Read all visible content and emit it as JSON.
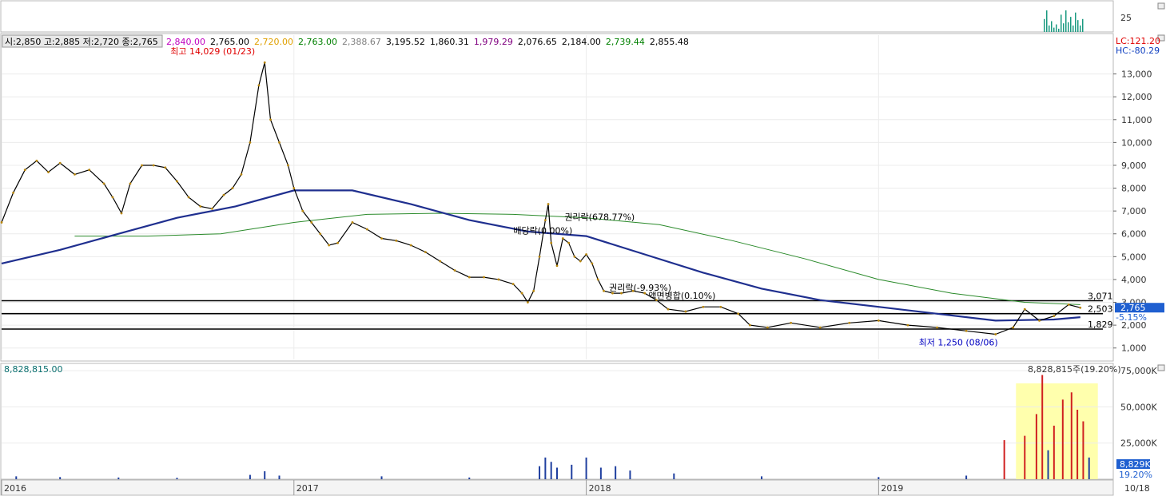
{
  "chart_data": [
    {
      "type": "line",
      "panel": "price",
      "info_bar": {
        "ohlc": "시:2,850 고:2,885 저:2,720 종:2,765",
        "ma_values": [
          {
            "text": "2,840.00",
            "color": "#c000c0"
          },
          {
            "text": "2,765.00",
            "color": "#000000"
          },
          {
            "text": "2,720.00",
            "color": "#e0a000"
          },
          {
            "text": "2,763.00",
            "color": "#008000"
          },
          {
            "text": "2,388.67",
            "color": "#808080"
          },
          {
            "text": "3,195.52",
            "color": "#000000"
          },
          {
            "text": "1,860.31",
            "color": "#000000"
          },
          {
            "text": "1,979.29",
            "color": "#800080"
          },
          {
            "text": "2,076.65",
            "color": "#000000"
          },
          {
            "text": "2,184.00",
            "color": "#000000"
          },
          {
            "text": "2,739.44",
            "color": "#008000"
          },
          {
            "text": "2,855.48",
            "color": "#000000"
          }
        ]
      },
      "lc_label": "LC:121.20",
      "hc_label": "HC:-80.29",
      "y_ticks": [
        1000,
        2000,
        3000,
        4000,
        5000,
        6000,
        7000,
        8000,
        9000,
        10000,
        11000,
        12000,
        13000
      ],
      "y_tick_labels": [
        "1,000",
        "2,000",
        "3,000",
        "4,000",
        "5,000",
        "6,000",
        "7,000",
        "8,000",
        "9,000",
        "10,000",
        "11,000",
        "12,000",
        "13,000"
      ],
      "ylim": [
        500,
        14700
      ],
      "x_labels": [
        "2016",
        "2017",
        "2018",
        "2019",
        "10/18"
      ],
      "x_label_dates": [
        2016.0,
        2017.0,
        2018.0,
        2019.0
      ],
      "xlim": [
        2016.0,
        2019.8
      ],
      "price_series": [
        [
          2016.0,
          6500
        ],
        [
          2016.04,
          7800
        ],
        [
          2016.08,
          8800
        ],
        [
          2016.12,
          9200
        ],
        [
          2016.16,
          8700
        ],
        [
          2016.2,
          9100
        ],
        [
          2016.25,
          8600
        ],
        [
          2016.3,
          8800
        ],
        [
          2016.35,
          8200
        ],
        [
          2016.38,
          7600
        ],
        [
          2016.41,
          6900
        ],
        [
          2016.44,
          8200
        ],
        [
          2016.48,
          9000
        ],
        [
          2016.52,
          9000
        ],
        [
          2016.56,
          8900
        ],
        [
          2016.6,
          8300
        ],
        [
          2016.64,
          7600
        ],
        [
          2016.68,
          7200
        ],
        [
          2016.72,
          7100
        ],
        [
          2016.76,
          7700
        ],
        [
          2016.79,
          8000
        ],
        [
          2016.82,
          8600
        ],
        [
          2016.85,
          10000
        ],
        [
          2016.88,
          12500
        ],
        [
          2016.9,
          13500
        ],
        [
          2016.92,
          11000
        ],
        [
          2016.95,
          10000
        ],
        [
          2016.98,
          9000
        ],
        [
          2017.0,
          8000
        ],
        [
          2017.03,
          7000
        ],
        [
          2017.06,
          6500
        ],
        [
          2017.09,
          6000
        ],
        [
          2017.12,
          5500
        ],
        [
          2017.15,
          5600
        ],
        [
          2017.2,
          6500
        ],
        [
          2017.25,
          6200
        ],
        [
          2017.3,
          5800
        ],
        [
          2017.35,
          5700
        ],
        [
          2017.4,
          5500
        ],
        [
          2017.45,
          5200
        ],
        [
          2017.5,
          4800
        ],
        [
          2017.55,
          4400
        ],
        [
          2017.6,
          4100
        ],
        [
          2017.65,
          4100
        ],
        [
          2017.7,
          4000
        ],
        [
          2017.75,
          3800
        ],
        [
          2017.78,
          3400
        ],
        [
          2017.8,
          3000
        ],
        [
          2017.82,
          3500
        ],
        [
          2017.84,
          5000
        ],
        [
          2017.86,
          6600
        ],
        [
          2017.87,
          7300
        ],
        [
          2017.88,
          5600
        ],
        [
          2017.9,
          4600
        ],
        [
          2017.92,
          5800
        ],
        [
          2017.94,
          5600
        ],
        [
          2017.96,
          5000
        ],
        [
          2017.98,
          4800
        ],
        [
          2018.0,
          5100
        ],
        [
          2018.02,
          4700
        ],
        [
          2018.04,
          4000
        ],
        [
          2018.06,
          3500
        ],
        [
          2018.09,
          3400
        ],
        [
          2018.12,
          3400
        ],
        [
          2018.16,
          3500
        ],
        [
          2018.2,
          3400
        ],
        [
          2018.24,
          3100
        ],
        [
          2018.28,
          2700
        ],
        [
          2018.34,
          2600
        ],
        [
          2018.4,
          2800
        ],
        [
          2018.46,
          2800
        ],
        [
          2018.52,
          2500
        ],
        [
          2018.56,
          2000
        ],
        [
          2018.62,
          1900
        ],
        [
          2018.7,
          2100
        ],
        [
          2018.8,
          1900
        ],
        [
          2018.9,
          2100
        ],
        [
          2019.0,
          2200
        ],
        [
          2019.1,
          2000
        ],
        [
          2019.2,
          1900
        ],
        [
          2019.3,
          1750
        ],
        [
          2019.4,
          1600
        ],
        [
          2019.46,
          1900
        ],
        [
          2019.5,
          2700
        ],
        [
          2019.55,
          2200
        ],
        [
          2019.6,
          2400
        ],
        [
          2019.65,
          2900
        ],
        [
          2019.69,
          2765
        ]
      ],
      "long_ma_series": [
        [
          2016.0,
          4700
        ],
        [
          2016.2,
          5300
        ],
        [
          2016.4,
          6000
        ],
        [
          2016.6,
          6700
        ],
        [
          2016.8,
          7200
        ],
        [
          2017.0,
          7900
        ],
        [
          2017.2,
          7900
        ],
        [
          2017.4,
          7300
        ],
        [
          2017.6,
          6600
        ],
        [
          2017.8,
          6100
        ],
        [
          2018.0,
          5900
        ],
        [
          2018.2,
          5100
        ],
        [
          2018.4,
          4300
        ],
        [
          2018.6,
          3600
        ],
        [
          2018.8,
          3100
        ],
        [
          2019.0,
          2800
        ],
        [
          2019.2,
          2500
        ],
        [
          2019.4,
          2200
        ],
        [
          2019.6,
          2250
        ],
        [
          2019.69,
          2350
        ]
      ],
      "green_ma_series": [
        [
          2016.25,
          5900
        ],
        [
          2016.5,
          5900
        ],
        [
          2016.75,
          6000
        ],
        [
          2017.0,
          6500
        ],
        [
          2017.25,
          6850
        ],
        [
          2017.5,
          6900
        ],
        [
          2017.75,
          6850
        ],
        [
          2018.0,
          6700
        ],
        [
          2018.25,
          6400
        ],
        [
          2018.5,
          5700
        ],
        [
          2018.75,
          4900
        ],
        [
          2019.0,
          4000
        ],
        [
          2019.25,
          3400
        ],
        [
          2019.5,
          3000
        ],
        [
          2019.69,
          2900
        ]
      ],
      "annotations": [
        {
          "text": "최고 14,029 (01/23)",
          "date": 2016.9,
          "value": 14029,
          "color": "#e00000"
        },
        {
          "text": "배당락(0.00%)",
          "date": 2017.86,
          "value": 6000,
          "color": "#000000"
        },
        {
          "text": "권리락(678.77%)",
          "date": 2017.92,
          "value": 6600,
          "color": "#000000"
        },
        {
          "text": "권리락(-9.93%)",
          "date": 2018.1,
          "value": 3500,
          "color": "#000000"
        },
        {
          "text": "액면병합(0.10%)",
          "date": 2018.24,
          "value": 3150,
          "color": "#000000"
        },
        {
          "text": "최저 1,250 (08/06)",
          "date": 2019.46,
          "value": 1250,
          "color": "#0000c0"
        }
      ],
      "horizontal_levels": [
        {
          "text": "3,071",
          "value": 3071
        },
        {
          "text": "2,503",
          "value": 2503
        },
        {
          "text": "1,829",
          "value": 1829
        }
      ],
      "current_price_tag": "2,765",
      "change_tag": "-5.15%"
    },
    {
      "type": "bar",
      "panel": "volume",
      "label": "8,828,815.00",
      "peak_label": "8,828,815주(19.20%)",
      "y_ticks": [
        25000,
        50000,
        75000
      ],
      "y_tick_labels": [
        "25,000K",
        "50,000K",
        "75,000K"
      ],
      "ylim": [
        0,
        80000
      ],
      "current_volume_tag": "8,829K",
      "current_ratio_tag": "19.20%",
      "highlight_range": [
        2019.47,
        2019.75
      ],
      "volumes": [
        [
          2016.05,
          2000
        ],
        [
          2016.2,
          1500
        ],
        [
          2016.4,
          1200
        ],
        [
          2016.6,
          1000
        ],
        [
          2016.85,
          3000
        ],
        [
          2016.9,
          5500
        ],
        [
          2016.95,
          2500
        ],
        [
          2017.3,
          2000
        ],
        [
          2017.6,
          1200
        ],
        [
          2017.84,
          9000
        ],
        [
          2017.86,
          15000
        ],
        [
          2017.88,
          12000
        ],
        [
          2017.9,
          8000
        ],
        [
          2017.95,
          10000
        ],
        [
          2018.0,
          15000
        ],
        [
          2018.05,
          8000
        ],
        [
          2018.1,
          9000
        ],
        [
          2018.15,
          6000
        ],
        [
          2018.3,
          4000
        ],
        [
          2018.6,
          2000
        ],
        [
          2019.0,
          1500
        ],
        [
          2019.3,
          2500
        ],
        [
          2019.43,
          27000
        ],
        [
          2019.5,
          30000
        ],
        [
          2019.54,
          45000
        ],
        [
          2019.56,
          72000
        ],
        [
          2019.58,
          20000
        ],
        [
          2019.6,
          37000
        ],
        [
          2019.63,
          55000
        ],
        [
          2019.66,
          60000
        ],
        [
          2019.68,
          48000
        ],
        [
          2019.7,
          40000
        ],
        [
          2019.72,
          15000
        ]
      ]
    }
  ],
  "top_panel": {
    "tick_label": "25",
    "mini_bars": [
      0.6,
      1.0,
      0.3,
      0.5,
      0.2,
      0.35,
      0.15,
      0.8,
      0.4,
      1.0,
      0.45,
      0.7,
      0.3,
      0.9,
      0.55,
      0.3,
      0.6
    ]
  }
}
